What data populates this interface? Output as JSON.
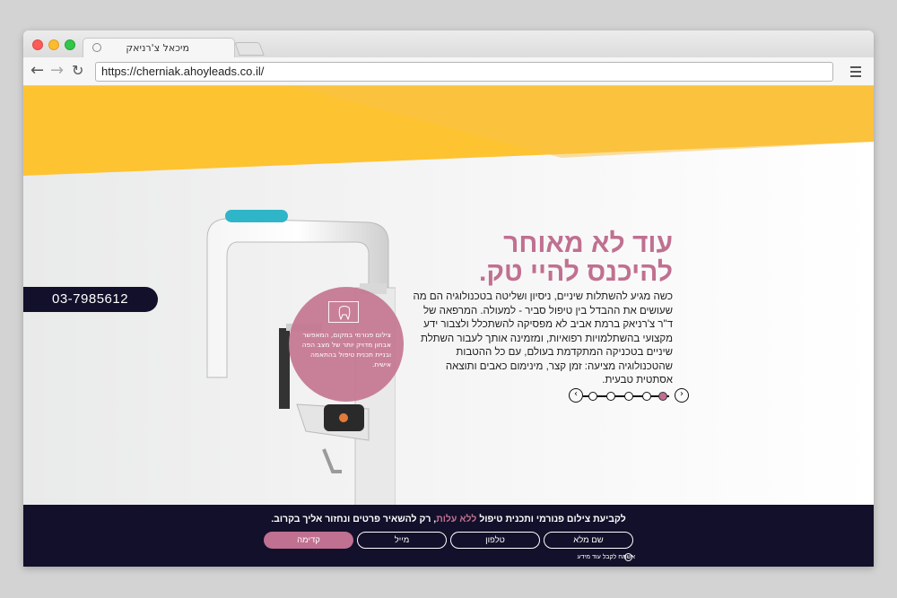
{
  "browser": {
    "tab_title": "מיכאל צ'רניאק",
    "url": "https://cherniak.ahoyleads.co.il/"
  },
  "site": {
    "phone": "03-7985612",
    "headline_line1": "עוד לא מאוחר",
    "headline_line2": "להיכנס להיי טק.",
    "body": "כשה מגיע להשתלות שיניים, ניסיון ושליטה בטכנולוגיה הם מה שעושים את ההבדל בין טיפול סביר - למעולה. המרפאה של ד\"ר צ'רניאק ברמת אביב לא מפסיקה להשתכלל ולצבור ידע מקצועי בהשתלמויות רפואיות, ומזמינה אותך לעבור השתלת שיניים בטכניקה המתקדמת בעולם, עם כל ההטבות שהטכנולוגיה מציעה: זמן קצר, מינימום כאבים ותוצאה אסתטית טבעית.",
    "circle_text": "צילום פנורמי במקום, המאפשר אבחון מדויק יותר של מצב הפה ובניית תכנית טיפול בהתאמה אישית.",
    "slider": {
      "total": 5,
      "active": 5
    }
  },
  "form": {
    "title_before": "לקביעת צילום פנורמי ותכנית טיפול",
    "title_highlight": "ללא עלות",
    "title_after": ", רק להשאיר פרטים ונחזור אליך בקרוב.",
    "name_placeholder": "שם מלא",
    "phone_placeholder": "טלפון",
    "email_placeholder": "מייל",
    "submit_label": "קדימה",
    "consent_label": "אשמח לקבל עוד מידע"
  },
  "colors": {
    "accent_pink": "#c07090",
    "yellow": "#fec331",
    "navy": "#12102a"
  }
}
